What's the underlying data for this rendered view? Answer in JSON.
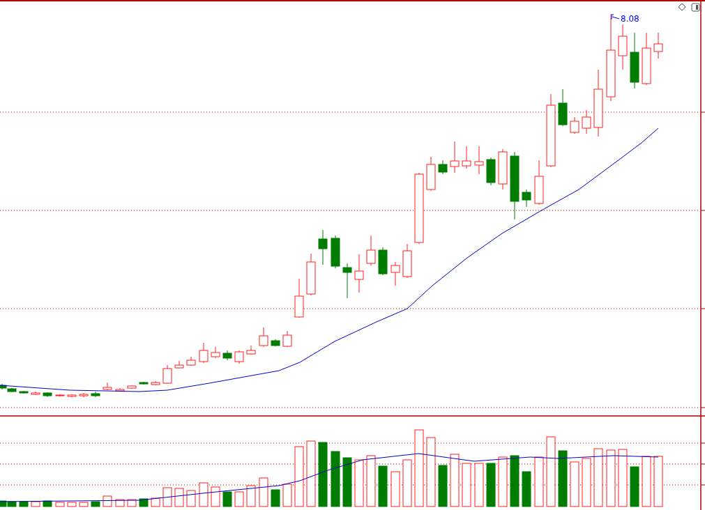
{
  "price_panel": {
    "high_label": "8.08"
  }
}
